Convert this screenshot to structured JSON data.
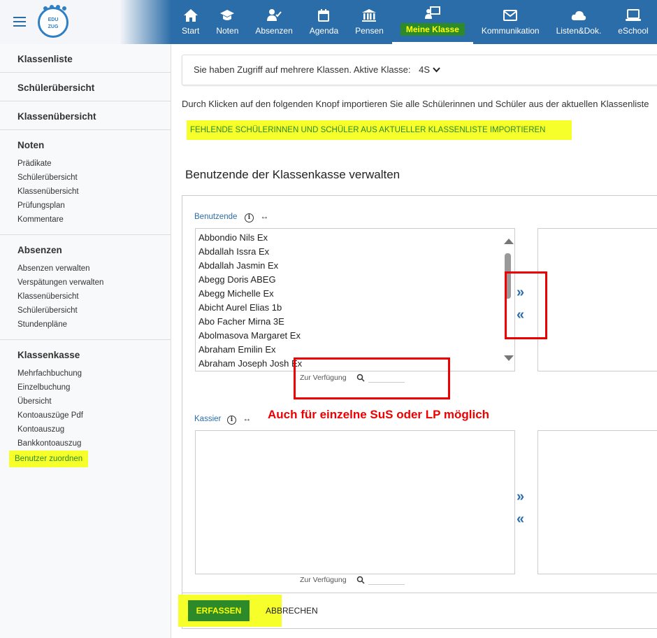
{
  "header": {
    "logo_text_1": "EDU",
    "logo_text_2": "ZUG",
    "nav": [
      {
        "label": "Start",
        "icon": "home-icon"
      },
      {
        "label": "Noten",
        "icon": "graduation-cap-icon"
      },
      {
        "label": "Absenzen",
        "icon": "user-check-icon"
      },
      {
        "label": "Agenda",
        "icon": "calendar-icon"
      },
      {
        "label": "Pensen",
        "icon": "institution-icon"
      },
      {
        "label": "Meine Klasse",
        "icon": "teacher-board-icon"
      },
      {
        "label": "Kommunikation",
        "icon": "envelope-icon"
      },
      {
        "label": "Listen&Dok.",
        "icon": "cloud-icon"
      },
      {
        "label": "eSchool",
        "icon": "laptop-icon"
      }
    ],
    "active_nav": "Meine Klasse"
  },
  "sidebar": {
    "groups": [
      {
        "title": "Klassenliste",
        "items": []
      },
      {
        "title": "Schülerübersicht",
        "items": []
      },
      {
        "title": "Klassenübersicht",
        "items": []
      },
      {
        "title": "Noten",
        "items": [
          "Prädikate",
          "Schülerübersicht",
          "Klassenübersicht",
          "Prüfungsplan",
          "Kommentare"
        ]
      },
      {
        "title": "Absenzen",
        "items": [
          "Absenzen verwalten",
          "Verspätungen verwalten",
          "Klassenübersicht",
          "Schülerübersicht",
          "Stundenpläne"
        ]
      },
      {
        "title": "Klassenkasse",
        "items": [
          "Mehrfachbuchung",
          "Einzelbuchung",
          "Übersicht",
          "Kontoauszüge Pdf",
          "Kontoauszug",
          "Bankkontoauszug",
          "Benutzer zuordnen"
        ]
      }
    ],
    "active_item": "Benutzer zuordnen"
  },
  "main": {
    "access_text": "Sie haben Zugriff auf mehrere Klassen. Aktive Klasse:",
    "active_class": "4S",
    "import_text": "Durch Klicken auf den folgenden Knopf importieren Sie alle Schülerinnen und Schüler aus der aktuellen Klassenliste",
    "import_button": "FEHLENDE SCHÜLERINNEN UND SCHÜLER AUS AKTUELLER KLASSENLISTE IMPORTIEREN",
    "section_title": "Benutzende der Klassenkasse verwalten",
    "users_label": "Benutzende",
    "cashier_label": "Kassier",
    "filter_label": "Zur Verfügung",
    "users": [
      "Abbondio Nils Ex",
      "Abdallah Issra Ex",
      "Abdallah Jasmin Ex",
      "Abegg Doris ABEG",
      "Abegg Michelle Ex",
      "Abicht Aurel Elias 1b",
      "Abo Facher Mirna 3E",
      "Abolmasova Margaret Ex",
      "Abraham Emilin Ex",
      "Abraham Joseph Josh Ex"
    ],
    "move_right": "»",
    "move_left": "«",
    "annotation": "Auch für einzelne SuS oder LP möglich",
    "submit_label": "ERFASSEN",
    "cancel_label": "ABBRECHEN"
  },
  "colors": {
    "header_blue": "#2b6da8",
    "highlight_yellow": "#f7ff2a",
    "active_green": "#2d8a2a",
    "annotation_red": "#e00000"
  }
}
